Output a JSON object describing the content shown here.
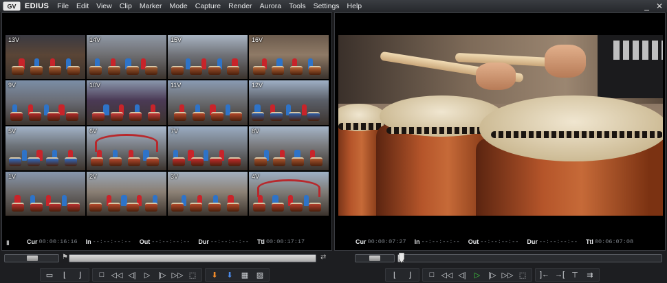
{
  "app": {
    "name": "EDIUS",
    "logo": "gv-logo-icon",
    "menu": [
      "File",
      "Edit",
      "View",
      "Clip",
      "Marker",
      "Mode",
      "Capture",
      "Render",
      "Aurora",
      "Tools",
      "Settings",
      "Help"
    ],
    "window_controls": {
      "minimize": "_",
      "close": "✕"
    }
  },
  "player": {
    "cameras": [
      {
        "label": "13V",
        "scene": "drums-close"
      },
      {
        "label": "14V",
        "scene": "drums-sky"
      },
      {
        "label": "15V",
        "scene": "drums-row"
      },
      {
        "label": "16V",
        "scene": "drums-closeup",
        "selected": true
      },
      {
        "label": "9V",
        "scene": "group-red"
      },
      {
        "label": "10V",
        "scene": "banner"
      },
      {
        "label": "11V",
        "scene": "group-wide"
      },
      {
        "label": "12V",
        "scene": "banner-right"
      },
      {
        "label": "5V",
        "scene": "blue-group"
      },
      {
        "label": "6V",
        "scene": "bridge"
      },
      {
        "label": "7V",
        "scene": "red-performer"
      },
      {
        "label": "8V",
        "scene": "drums-line"
      },
      {
        "label": "1V",
        "scene": "banner-wide"
      },
      {
        "label": "2V",
        "scene": "wide-plaza"
      },
      {
        "label": "3V",
        "scene": "wide-plaza-2"
      },
      {
        "label": "4V",
        "scene": "bridge-wide"
      }
    ],
    "timecodes": [
      {
        "label": "Cur",
        "value": "00:00:16:16"
      },
      {
        "label": "In",
        "value": "--:--:--:--"
      },
      {
        "label": "Out",
        "value": "--:--:--:--"
      },
      {
        "label": "Dur",
        "value": "--:--:--:--"
      },
      {
        "label": "Ttl",
        "value": "00:00:17:17"
      }
    ]
  },
  "recorder": {
    "timecodes": [
      {
        "label": "Cur",
        "value": "00:00:07:27"
      },
      {
        "label": "In",
        "value": "--:--:--:--"
      },
      {
        "label": "Out",
        "value": "--:--:--:--"
      },
      {
        "label": "Dur",
        "value": "--:--:--:--"
      },
      {
        "label": "Ttl",
        "value": "00:06:07:08"
      }
    ]
  },
  "transport": {
    "player_position": 1.0,
    "recorder_position": 0.02
  }
}
